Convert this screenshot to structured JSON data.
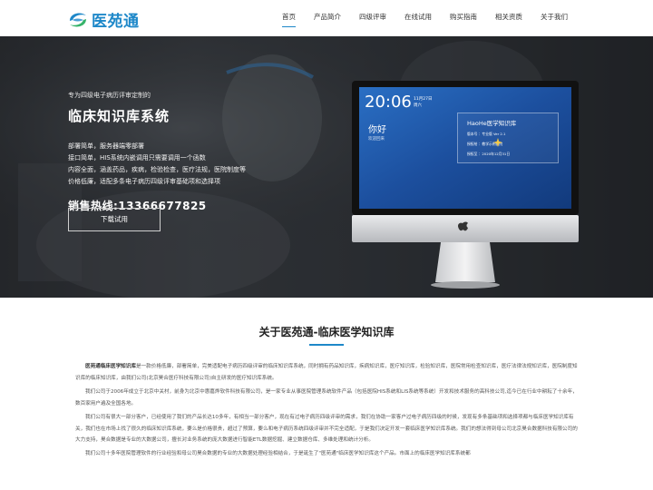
{
  "header": {
    "logo_text": "医苑通",
    "nav": [
      {
        "label": "首页",
        "active": true
      },
      {
        "label": "产品简介",
        "active": false
      },
      {
        "label": "四级评审",
        "active": false
      },
      {
        "label": "在线试用",
        "active": false
      },
      {
        "label": "购买指南",
        "active": false
      },
      {
        "label": "相关资质",
        "active": false
      },
      {
        "label": "关于我们",
        "active": false
      }
    ]
  },
  "hero": {
    "subtitle": "专为四级电子病历评审定制的",
    "title": "临床知识库系统",
    "features": [
      "部署简单，服务器端零部署",
      "接口简单，HIS系统内嵌调用只需要调用一个函数",
      "内容全面，涵盖药品，疾病，检验检查，医疗法规，医院制度等",
      "价格低廉，适配多条电子病历四级评审基础项和选择项"
    ],
    "phone": "销售热线:13366677825",
    "button": "下载试用"
  },
  "screen": {
    "time": "20:06",
    "date_top": "11月27日",
    "date_bottom": "周六",
    "greeting": "你好",
    "greeting_sub": "欢迎回来",
    "app_title": "HaoHe医学知识库",
    "rows": [
      "版本号 ：专业版 Ver 2.1",
      "授权给 ：教学示例医院",
      "授权至 ：2020年12月31日"
    ]
  },
  "about": {
    "title": "关于医苑通-临床医学知识库",
    "paragraphs": [
      {
        "lead": "医苑通临床医学知识库",
        "text": "是一款价格低廉，部署简单，完美适配电子病历四级评审的临床知识库系统，同时拥有药品知识库，疾病知识库，医疗知识库，检验知识库，医院常用检查知识库，医疗法律法规知识库，医院制度知识库的临床知识库，由我们公司(北京昊合医疗科技有限公司)自主研发的医疗知识库系统。"
      },
      {
        "lead": "",
        "text": "我们公司于2006年成立于北京中关村，前身为北京中惠嘉烨软件科技有限公司，是一家专业从事医院管理系统软件产品（包括医院HIS系统和LIS系统等系统）开发和技术服务的高科技公司,迄今已在行业中耕耘了十余年，数百家用户遍及全国各地。"
      },
      {
        "lead": "",
        "text": "我们公司有很大一部分客户，已经使用了我们的产品长达10多年，有相当一部分客户，现在有过电子病历四级评审的需求，我们在协助一家客户过电子病历四级的时候，发现有多条基础项和选择项都与临床医学知识库有关，我们也在市场上找了很久的临床知识库系统，要么是价格很贵，超过了预算，要么和电子病历系统四级评审并不完全适配，于是我们决定开发一套临床医学知识库系统。我们的想法得到母公司北京昊合数据科技有限公司的大力支持，昊合数据是专业的大数据公司，擅长对业务系统的庞大数据进行智能ETL数据挖掘、建立数据仓库、多维处理和统计分析。"
      },
      {
        "lead": "",
        "text": "我们公司十多年医院管理软件的行业经验和母公司昊合数据的专业的大数据处理经验相结合，于是诞生了\"医苑通\"临床医学知识库这个产品。市面上的临床医学知识库系统都"
      }
    ]
  }
}
